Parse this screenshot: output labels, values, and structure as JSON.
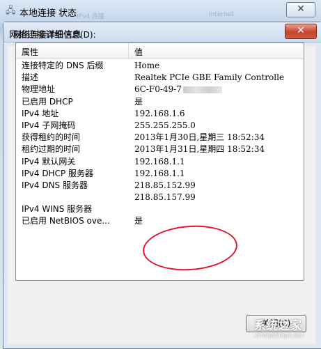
{
  "parent_window": {
    "title": "本地连接 状态",
    "close_glyph": "✕",
    "faded_tabs": [
      "IPv4 连接",
      "Internet"
    ]
  },
  "dialog": {
    "title": "网络连接详细信息",
    "close_glyph": "✕",
    "group_label": "网络连接详细信息(D):",
    "columns": [
      "属性",
      "值"
    ],
    "rows": [
      {
        "property": "连接特定的 DNS 后缀",
        "value": "Home"
      },
      {
        "property": "描述",
        "value": "Realtek PCIe GBE Family Controlle"
      },
      {
        "property": "物理地址",
        "value": "6C-F0-49-7"
      },
      {
        "property": "已启用 DHCP",
        "value": "是"
      },
      {
        "property": "IPv4 地址",
        "value": "192.168.1.6"
      },
      {
        "property": "IPv4 子网掩码",
        "value": "255.255.255.0"
      },
      {
        "property": "获得租约的时间",
        "value": "2013年1月30日,星期三 18:52:34"
      },
      {
        "property": "租约过期的时间",
        "value": "2013年1月31日,星期四 18:52:34"
      },
      {
        "property": "IPv4 默认网关",
        "value": "192.168.1.1"
      },
      {
        "property": "IPv4 DHCP 服务器",
        "value": "192.168.1.1"
      },
      {
        "property": "IPv4 DNS 服务器",
        "value": "218.85.152.99"
      },
      {
        "property": "",
        "value": "218.85.157.99"
      },
      {
        "property": "IPv4 WINS 服务器",
        "value": ""
      },
      {
        "property": "已启用 NetBIOS ove...",
        "value": "是"
      }
    ],
    "close_button_label": "关闭(C)"
  },
  "watermark": {
    "main": "系统之家",
    "sub": "XITONGZHIJIA.NET"
  },
  "colors": {
    "highlight_circle": "#e0152b",
    "title_close": "#c7432c"
  }
}
